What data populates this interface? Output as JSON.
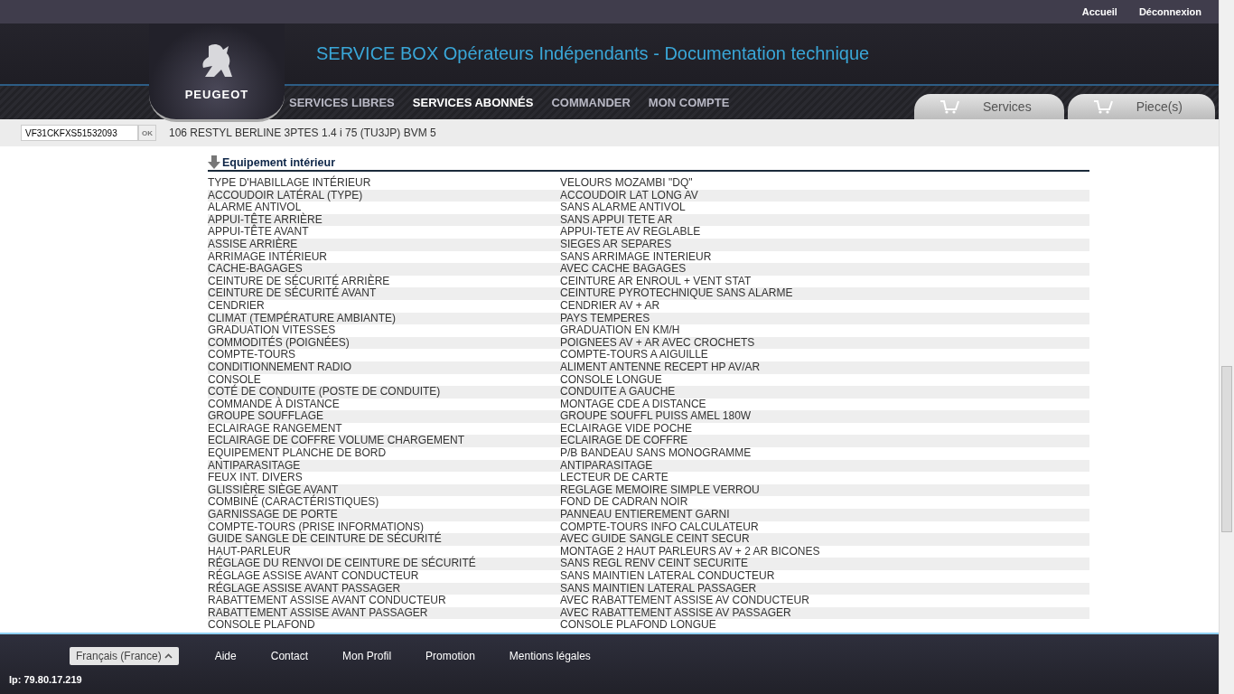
{
  "top_links": [
    "Accueil",
    "Déconnexion"
  ],
  "header": {
    "brand": "PEUGEOT",
    "title": "SERVICE BOX Opérateurs Indépendants - Documentation technique"
  },
  "nav": [
    {
      "label": "SERVICES LIBRES",
      "selected": false
    },
    {
      "label": "SERVICES ABONNÉS",
      "selected": true
    },
    {
      "label": "COMMANDER",
      "selected": false
    },
    {
      "label": "MON COMPTE",
      "selected": false
    }
  ],
  "cart_tabs": [
    "Services",
    "Piece(s)"
  ],
  "vehicle": {
    "vin": "VF31CKFXS51532093",
    "ok": "OK",
    "description": "106 RESTYL BERLINE 3PTES 1.4 i 75 (TU3JP) BVM 5"
  },
  "section": {
    "title": "Equipement intérieur",
    "rows": [
      {
        "label": "TYPE D'HABILLAGE INTÉRIEUR",
        "value": "VELOURS MOZAMBI \"DQ\""
      },
      {
        "label": "ACCOUDOIR LATÉRAL (TYPE)",
        "value": "ACCOUDOIR LAT LONG AV"
      },
      {
        "label": "ALARME ANTIVOL",
        "value": "SANS ALARME ANTIVOL"
      },
      {
        "label": "APPUI-TÊTE ARRIÈRE",
        "value": "SANS APPUI TETE AR"
      },
      {
        "label": "APPUI-TÊTE AVANT",
        "value": "APPUI-TETE AV REGLABLE"
      },
      {
        "label": "ASSISE ARRIÈRE",
        "value": "SIEGES AR SEPARES"
      },
      {
        "label": "ARRIMAGE INTÉRIEUR",
        "value": "SANS ARRIMAGE INTERIEUR"
      },
      {
        "label": "CACHE-BAGAGES",
        "value": "AVEC CACHE BAGAGES"
      },
      {
        "label": "CEINTURE DE SÉCURITÉ ARRIÈRE",
        "value": "CEINTURE AR ENROUL + VENT STAT"
      },
      {
        "label": "CEINTURE DE SÉCURITÉ AVANT",
        "value": "CEINTURE PYROTECHNIQUE SANS ALARME"
      },
      {
        "label": "CENDRIER",
        "value": "CENDRIER AV + AR"
      },
      {
        "label": "CLIMAT (TEMPÉRATURE AMBIANTE)",
        "value": "PAYS TEMPERES"
      },
      {
        "label": "GRADUATION VITESSES",
        "value": "GRADUATION EN KM/H"
      },
      {
        "label": "COMMODITÉS (POIGNÉES)",
        "value": "POIGNEES AV + AR AVEC CROCHETS"
      },
      {
        "label": "COMPTE-TOURS",
        "value": "COMPTE-TOURS A AIGUILLE"
      },
      {
        "label": "CONDITIONNEMENT RADIO",
        "value": "ALIMENT ANTENNE RECEPT HP AV/AR"
      },
      {
        "label": "CONSOLE",
        "value": "CONSOLE LONGUE"
      },
      {
        "label": "COTÉ DE CONDUITE (POSTE DE CONDUITE)",
        "value": "CONDUITE A GAUCHE"
      },
      {
        "label": "COMMANDE À DISTANCE",
        "value": "MONTAGE CDE A DISTANCE"
      },
      {
        "label": "GROUPE SOUFFLAGE",
        "value": "GROUPE SOUFFL PUISS AMEL 180W"
      },
      {
        "label": "ECLAIRAGE RANGEMENT",
        "value": "ECLAIRAGE VIDE POCHE"
      },
      {
        "label": "ECLAIRAGE DE COFFRE VOLUME CHARGEMENT",
        "value": "ECLAIRAGE DE COFFRE"
      },
      {
        "label": "EQUIPEMENT PLANCHE DE BORD",
        "value": "P/B BANDEAU SANS MONOGRAMME"
      },
      {
        "label": "ANTIPARASITAGE",
        "value": "ANTIPARASITAGE"
      },
      {
        "label": "FEUX INT. DIVERS",
        "value": "LECTEUR DE CARTE"
      },
      {
        "label": "GLISSIÈRE SIÈGE AVANT",
        "value": "REGLAGE MEMOIRE SIMPLE VERROU"
      },
      {
        "label": "COMBINÉ (CARACTÉRISTIQUES)",
        "value": "FOND DE CADRAN NOIR"
      },
      {
        "label": "GARNISSAGE DE PORTE",
        "value": "PANNEAU ENTIEREMENT GARNI"
      },
      {
        "label": "COMPTE-TOURS (PRISE INFORMATIONS)",
        "value": "COMPTE-TOURS INFO CALCULATEUR"
      },
      {
        "label": "GUIDE SANGLE DE CEINTURE DE SÉCURITÉ",
        "value": "AVEC GUIDE SANGLE CEINT SECUR"
      },
      {
        "label": "HAUT-PARLEUR",
        "value": "MONTAGE 2 HAUT PARLEURS AV + 2 AR BICONES"
      },
      {
        "label": "RÉGLAGE DU RENVOI DE CEINTURE DE SÉCURITÉ",
        "value": "SANS REGL RENV CEINT SECURITE"
      },
      {
        "label": "RÉGLAGE ASSISE AVANT CONDUCTEUR",
        "value": "SANS MAINTIEN LATERAL CONDUCTEUR"
      },
      {
        "label": "RÉGLAGE ASSISE AVANT PASSAGER",
        "value": "SANS MAINTIEN LATERAL PASSAGER"
      },
      {
        "label": "RABATTEMENT ASSISE AVANT CONDUCTEUR",
        "value": "AVEC RABATTEMENT ASSISE AV CONDUCTEUR"
      },
      {
        "label": "RABATTEMENT ASSISE AVANT PASSAGER",
        "value": "AVEC RABATTEMENT ASSISE AV PASSAGER"
      },
      {
        "label": "CONSOLE PLAFOND",
        "value": "CONSOLE PLAFOND LONGUE"
      }
    ]
  },
  "footer": {
    "language": "Français (France)",
    "links": [
      "Aide",
      "Contact",
      "Mon Profil",
      "Promotion",
      "Mentions légales"
    ],
    "ip": "Ip: 79.80.17.219"
  }
}
